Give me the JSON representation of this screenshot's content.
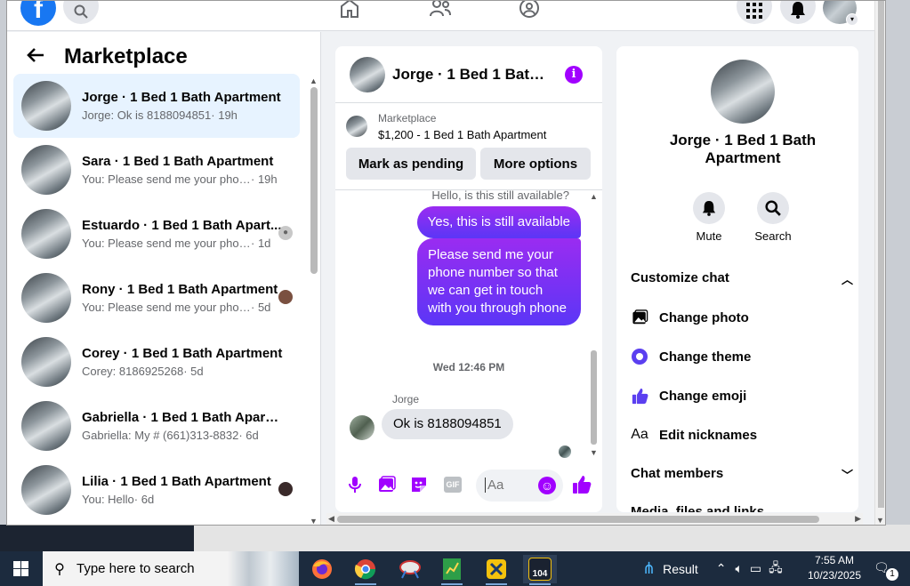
{
  "header": {
    "brand_letter": "f"
  },
  "sidebar": {
    "title": "Marketplace",
    "conversations": [
      {
        "name": "Jorge · 1 Bed 1 Bath Apartment",
        "snippet": "Jorge: Ok is 8188094851",
        "time": " · 19h",
        "active": true
      },
      {
        "name": "Sara · 1 Bed 1 Bath Apartment",
        "snippet": "You: Please send me your phone ...",
        "time": " · 19h"
      },
      {
        "name": "Estuardo · 1 Bed 1 Bath Apart...",
        "snippet": "You: Please send me your phon...",
        "time": " · 1d"
      },
      {
        "name": "Rony · 1 Bed 1 Bath Apartment",
        "snippet": "You: Please send me your phon...",
        "time": " · 5d"
      },
      {
        "name": "Corey · 1 Bed 1 Bath Apartment",
        "snippet": "Corey: 8186925268",
        "time": " · 5d"
      },
      {
        "name": "Gabriella · 1 Bed 1 Bath Apartm...",
        "snippet": "Gabriella: My # (661)313-8832",
        "time": " · 6d"
      },
      {
        "name": "Lilia · 1 Bed 1 Bath Apartment",
        "snippet": "You: Hello",
        "time": " · 6d"
      }
    ]
  },
  "chat": {
    "title": "Jorge · 1 Bed 1 Bath ...",
    "listing_source": "Marketplace",
    "listing_title": "$1,200 - 1 Bed 1 Bath Apartment",
    "mark_pending_label": "Mark as pending",
    "more_options_label": "More options",
    "messages": {
      "prev_partial": "Hello, is this still available?",
      "out1": "Yes, this is still available",
      "out2": "Please send me your phone  number so that we can get in touch with you through phone",
      "day_separator": "Wed 12:46 PM",
      "sender": "Jorge",
      "in1": "Ok is 8188094851"
    },
    "composer_placeholder": "Aa",
    "gif_label": "GIF"
  },
  "details": {
    "name": "Jorge · 1 Bed 1 Bath Apartment",
    "mute_label": "Mute",
    "search_label": "Search",
    "customize_title": "Customize chat",
    "change_photo": "Change photo",
    "change_theme": "Change theme",
    "change_emoji": "Change emoji",
    "edit_nicknames_icon": "Aa",
    "edit_nicknames": "Edit nicknames",
    "chat_members": "Chat members",
    "media_partial": "Media, files and links"
  },
  "taskbar": {
    "search_placeholder": "Type here to search",
    "widget_text": "Result",
    "time": "7:55 AM",
    "date": "10/23/2025",
    "notification_count": "1",
    "badge_104": "104"
  },
  "colors": {
    "accent": "#a100ff",
    "fb_blue": "#1877f2",
    "active_row": "#e7f3ff"
  }
}
